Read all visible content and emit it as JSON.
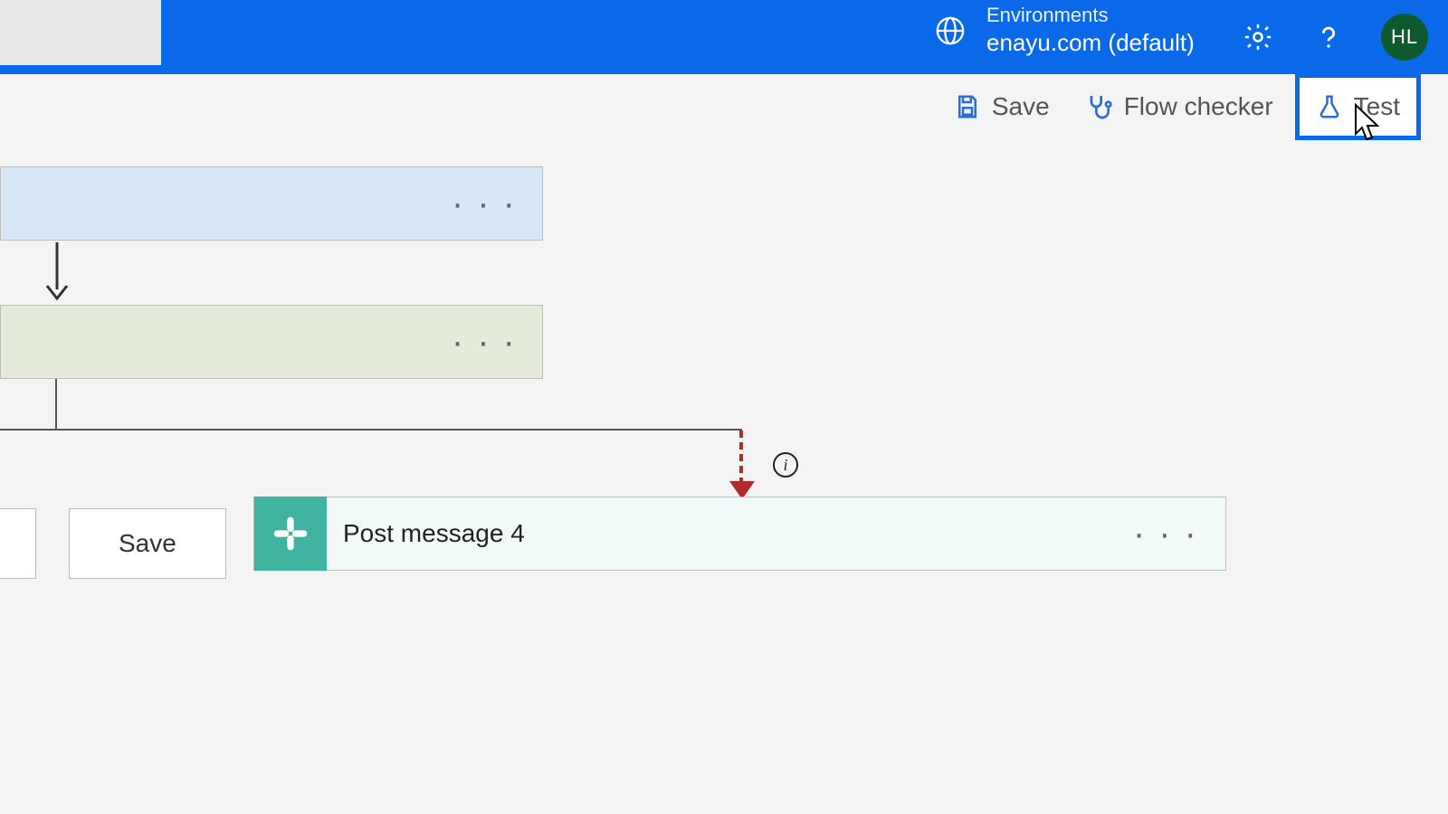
{
  "header": {
    "env_label": "Environments",
    "env_name": "enayu.com (default)",
    "avatar_initials": "HL"
  },
  "toolbar": {
    "save_label": "Save",
    "flow_checker_label": "Flow checker",
    "test_label": "Test"
  },
  "canvas": {
    "action_card_title": "Post message 4",
    "info_tooltip_glyph": "i"
  },
  "footer": {
    "save_label": "Save"
  },
  "colors": {
    "brand_blue": "#0a69e9",
    "card_blue": "#d8e7f8",
    "card_green": "#e4ecd9",
    "slack_teal": "#3fb39f",
    "error_red": "#b02a2a",
    "avatar_bg": "#0e5a2e"
  }
}
